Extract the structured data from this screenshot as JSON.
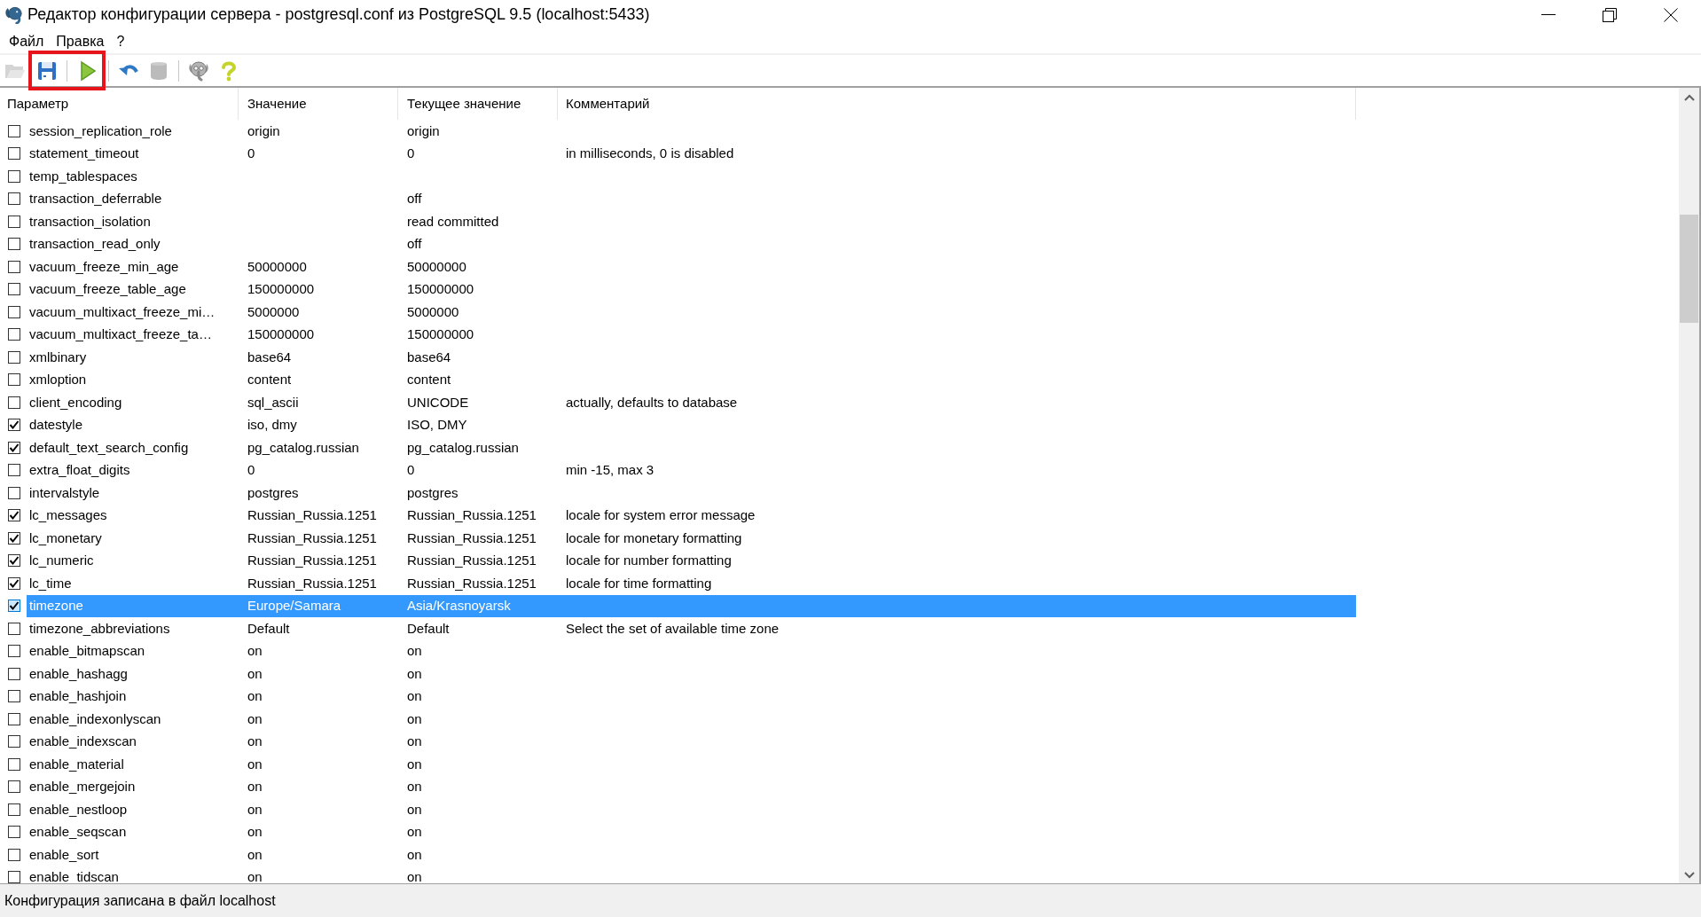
{
  "window": {
    "title": "Редактор конфигурации сервера - postgresql.conf из PostgreSQL 9.5 (localhost:5433)"
  },
  "menu": [
    {
      "label": "Файл"
    },
    {
      "label": "Правка"
    },
    {
      "label": "?"
    }
  ],
  "toolbar": [
    {
      "kind": "folder",
      "disabled": true,
      "highlighted": false
    },
    {
      "kind": "save",
      "disabled": false,
      "highlighted": true
    },
    {
      "kind": "separator",
      "highlighted": true
    },
    {
      "kind": "run",
      "disabled": false,
      "highlighted": true
    },
    {
      "kind": "separator",
      "highlighted": false
    },
    {
      "kind": "undo",
      "disabled": false,
      "highlighted": false
    },
    {
      "kind": "cylinder",
      "disabled": true,
      "highlighted": false
    },
    {
      "kind": "separator",
      "highlighted": false
    },
    {
      "kind": "elephant",
      "disabled": false,
      "highlighted": false
    },
    {
      "kind": "help",
      "disabled": false,
      "highlighted": false
    }
  ],
  "table": {
    "columns": [
      "Параметр",
      "Значение",
      "Текущее значение",
      "Комментарий"
    ],
    "rows": [
      {
        "checked": false,
        "selected": false,
        "parameter": "session_replication_role",
        "value": "origin",
        "current_value": "origin"
      },
      {
        "checked": false,
        "selected": false,
        "parameter": "statement_timeout",
        "value": "0",
        "current_value": "0",
        "comment": "in milliseconds, 0 is disabled"
      },
      {
        "checked": false,
        "selected": false,
        "parameter": "temp_tablespaces"
      },
      {
        "checked": false,
        "selected": false,
        "parameter": "transaction_deferrable",
        "current_value": "off"
      },
      {
        "checked": false,
        "selected": false,
        "parameter": "transaction_isolation",
        "current_value": "read committed"
      },
      {
        "checked": false,
        "selected": false,
        "parameter": "transaction_read_only",
        "current_value": "off"
      },
      {
        "checked": false,
        "selected": false,
        "parameter": "vacuum_freeze_min_age",
        "value": "50000000",
        "current_value": "50000000"
      },
      {
        "checked": false,
        "selected": false,
        "parameter": "vacuum_freeze_table_age",
        "value": "150000000",
        "current_value": "150000000"
      },
      {
        "checked": false,
        "selected": false,
        "parameter": "vacuum_multixact_freeze_mi…",
        "value": "5000000",
        "current_value": "5000000"
      },
      {
        "checked": false,
        "selected": false,
        "parameter": "vacuum_multixact_freeze_ta…",
        "value": "150000000",
        "current_value": "150000000"
      },
      {
        "checked": false,
        "selected": false,
        "parameter": "xmlbinary",
        "value": "base64",
        "current_value": "base64"
      },
      {
        "checked": false,
        "selected": false,
        "parameter": "xmloption",
        "value": "content",
        "current_value": "content"
      },
      {
        "checked": false,
        "selected": false,
        "parameter": "client_encoding",
        "value": "sql_ascii",
        "current_value": "UNICODE",
        "comment": "actually, defaults to database"
      },
      {
        "checked": true,
        "selected": false,
        "parameter": "datestyle",
        "value": "iso, dmy",
        "current_value": "ISO, DMY"
      },
      {
        "checked": true,
        "selected": false,
        "parameter": "default_text_search_config",
        "value": "pg_catalog.russian",
        "current_value": "pg_catalog.russian"
      },
      {
        "checked": false,
        "selected": false,
        "parameter": "extra_float_digits",
        "value": "0",
        "current_value": "0",
        "comment": "min -15, max 3"
      },
      {
        "checked": false,
        "selected": false,
        "parameter": "intervalstyle",
        "value": "postgres",
        "current_value": "postgres"
      },
      {
        "checked": true,
        "selected": false,
        "parameter": "lc_messages",
        "value": "Russian_Russia.1251",
        "current_value": "Russian_Russia.1251",
        "comment": "locale for system error message"
      },
      {
        "checked": true,
        "selected": false,
        "parameter": "lc_monetary",
        "value": "Russian_Russia.1251",
        "current_value": "Russian_Russia.1251",
        "comment": "locale for monetary formatting"
      },
      {
        "checked": true,
        "selected": false,
        "parameter": "lc_numeric",
        "value": "Russian_Russia.1251",
        "current_value": "Russian_Russia.1251",
        "comment": "locale for number formatting"
      },
      {
        "checked": true,
        "selected": false,
        "parameter": "lc_time",
        "value": "Russian_Russia.1251",
        "current_value": "Russian_Russia.1251",
        "comment": "locale for time formatting"
      },
      {
        "checked": true,
        "selected": true,
        "parameter": "timezone",
        "value": "Europe/Samara",
        "current_value": "Asia/Krasnoyarsk"
      },
      {
        "checked": false,
        "selected": false,
        "parameter": "timezone_abbreviations",
        "value": "Default",
        "current_value": "Default",
        "comment": "Select the set of available time zone"
      },
      {
        "checked": false,
        "selected": false,
        "parameter": "enable_bitmapscan",
        "value": "on",
        "current_value": "on"
      },
      {
        "checked": false,
        "selected": false,
        "parameter": "enable_hashagg",
        "value": "on",
        "current_value": "on"
      },
      {
        "checked": false,
        "selected": false,
        "parameter": "enable_hashjoin",
        "value": "on",
        "current_value": "on"
      },
      {
        "checked": false,
        "selected": false,
        "parameter": "enable_indexonlyscan",
        "value": "on",
        "current_value": "on"
      },
      {
        "checked": false,
        "selected": false,
        "parameter": "enable_indexscan",
        "value": "on",
        "current_value": "on"
      },
      {
        "checked": false,
        "selected": false,
        "parameter": "enable_material",
        "value": "on",
        "current_value": "on"
      },
      {
        "checked": false,
        "selected": false,
        "parameter": "enable_mergejoin",
        "value": "on",
        "current_value": "on"
      },
      {
        "checked": false,
        "selected": false,
        "parameter": "enable_nestloop",
        "value": "on",
        "current_value": "on"
      },
      {
        "checked": false,
        "selected": false,
        "parameter": "enable_seqscan",
        "value": "on",
        "current_value": "on"
      },
      {
        "checked": false,
        "selected": false,
        "parameter": "enable_sort",
        "value": "on",
        "current_value": "on"
      },
      {
        "checked": false,
        "selected": false,
        "parameter": "enable_tidscan",
        "value": "on",
        "current_value": "on"
      }
    ]
  },
  "status_bar": {
    "text": "Конфигурация записана в файл localhost"
  }
}
